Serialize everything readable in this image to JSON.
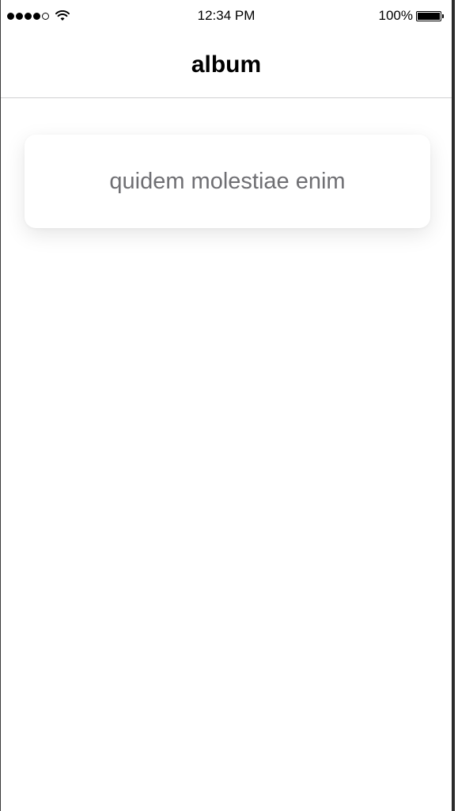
{
  "status_bar": {
    "time": "12:34 PM",
    "battery_percent": "100%",
    "signal_bars_filled": 4,
    "signal_bars_total": 5,
    "battery_level": 1.0
  },
  "nav": {
    "title": "album"
  },
  "albums": [
    {
      "title": "quidem molestiae enim"
    }
  ],
  "colors": {
    "background": "#ffffff",
    "card_text": "#6f6f73",
    "divider": "#cfcfd2"
  }
}
